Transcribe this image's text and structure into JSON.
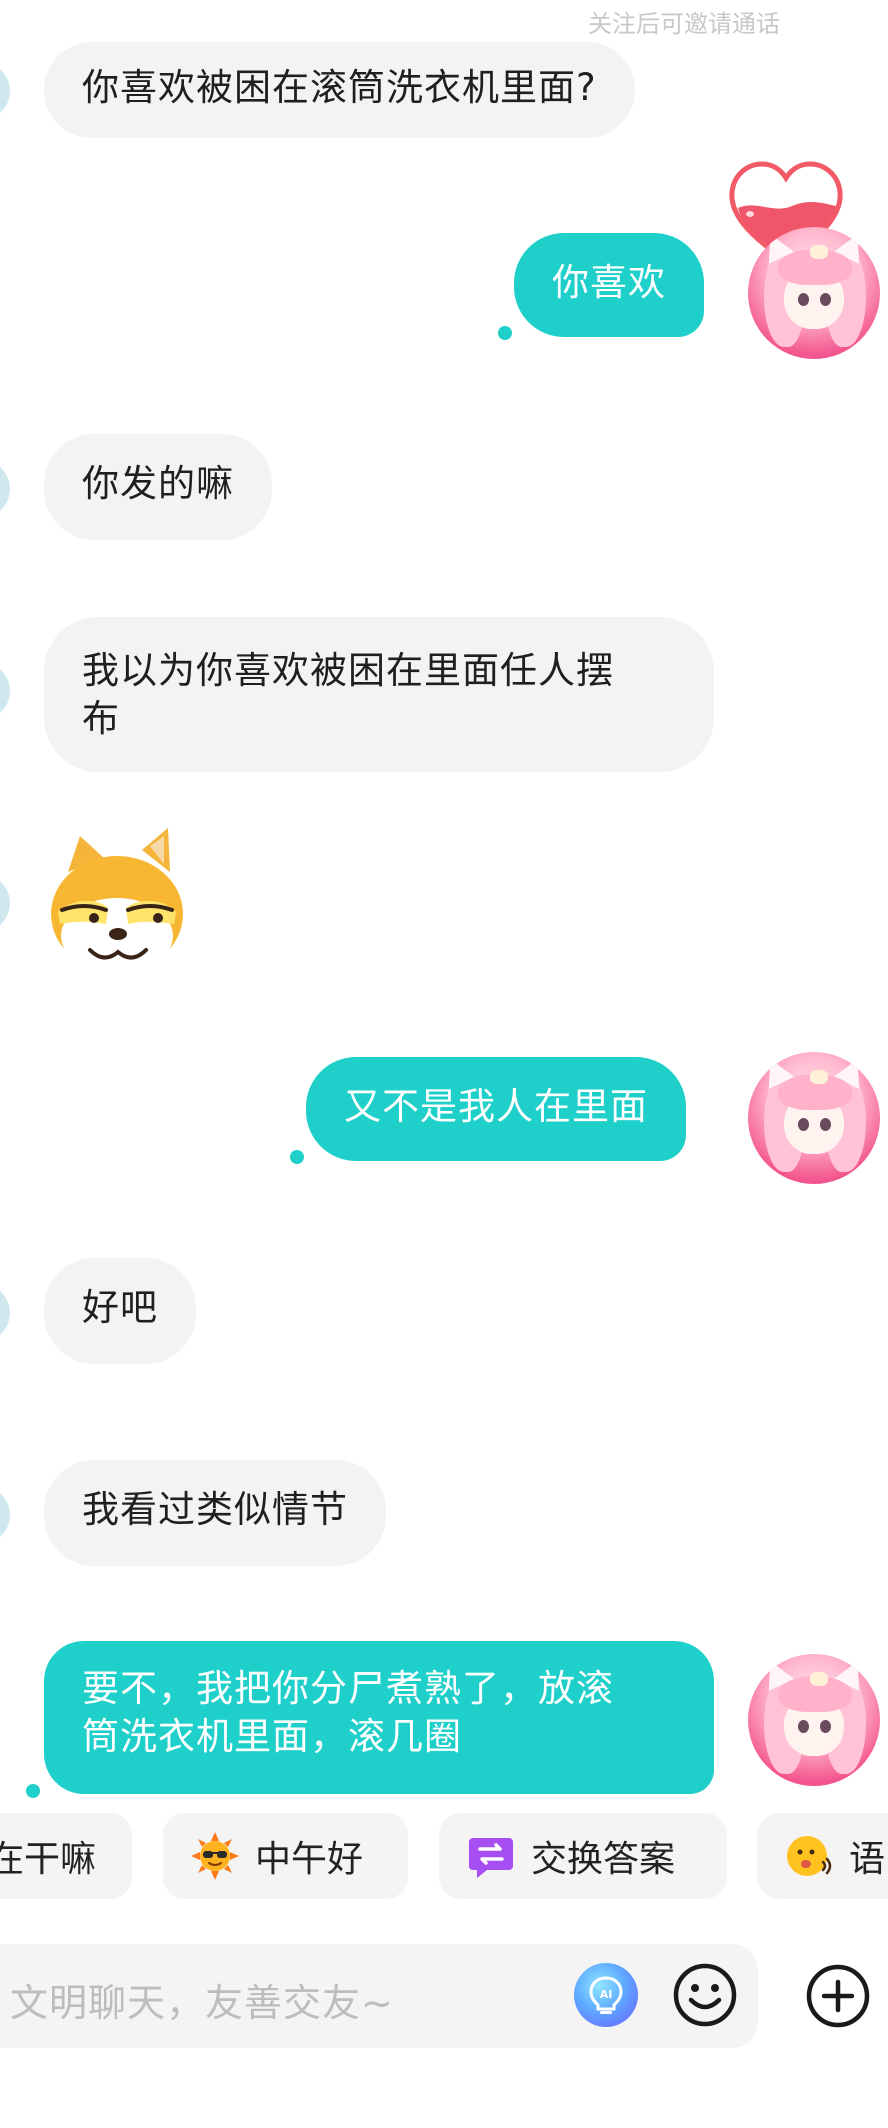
{
  "top_hint": "关注后可邀请通话",
  "messages": [
    {
      "side": "in",
      "text": "你喜欢被困在滚筒洗衣机里面?"
    },
    {
      "side": "out",
      "text": "你喜欢"
    },
    {
      "side": "in",
      "text": "你发的嘛"
    },
    {
      "side": "in",
      "text": "我以为你喜欢被困在里面任人摆\n布"
    },
    {
      "side": "in",
      "type": "sticker",
      "sticker": "shiba-smug-emoji"
    },
    {
      "side": "out",
      "text": "又不是我人在里面"
    },
    {
      "side": "in",
      "text": "好吧"
    },
    {
      "side": "in",
      "text": "我看过类似情节"
    },
    {
      "side": "out",
      "text": "要不，我把你分尸煮熟了，放滚\n筒洗衣机里面，滚几圈"
    }
  ],
  "quick_replies": [
    {
      "label": "在干嘛",
      "icon": ""
    },
    {
      "label": "中午好",
      "icon": "sun-sunglasses-icon"
    },
    {
      "label": "交换答案",
      "icon": "swap-icon"
    },
    {
      "label": "语",
      "icon": "voice-emoji-icon"
    }
  ],
  "input": {
    "placeholder": "文明聊天，友善交友~"
  },
  "colors": {
    "accent": "#1fd0ca",
    "incoming_bubble": "#f3f3f3",
    "hint_text": "#c8c8c8"
  }
}
